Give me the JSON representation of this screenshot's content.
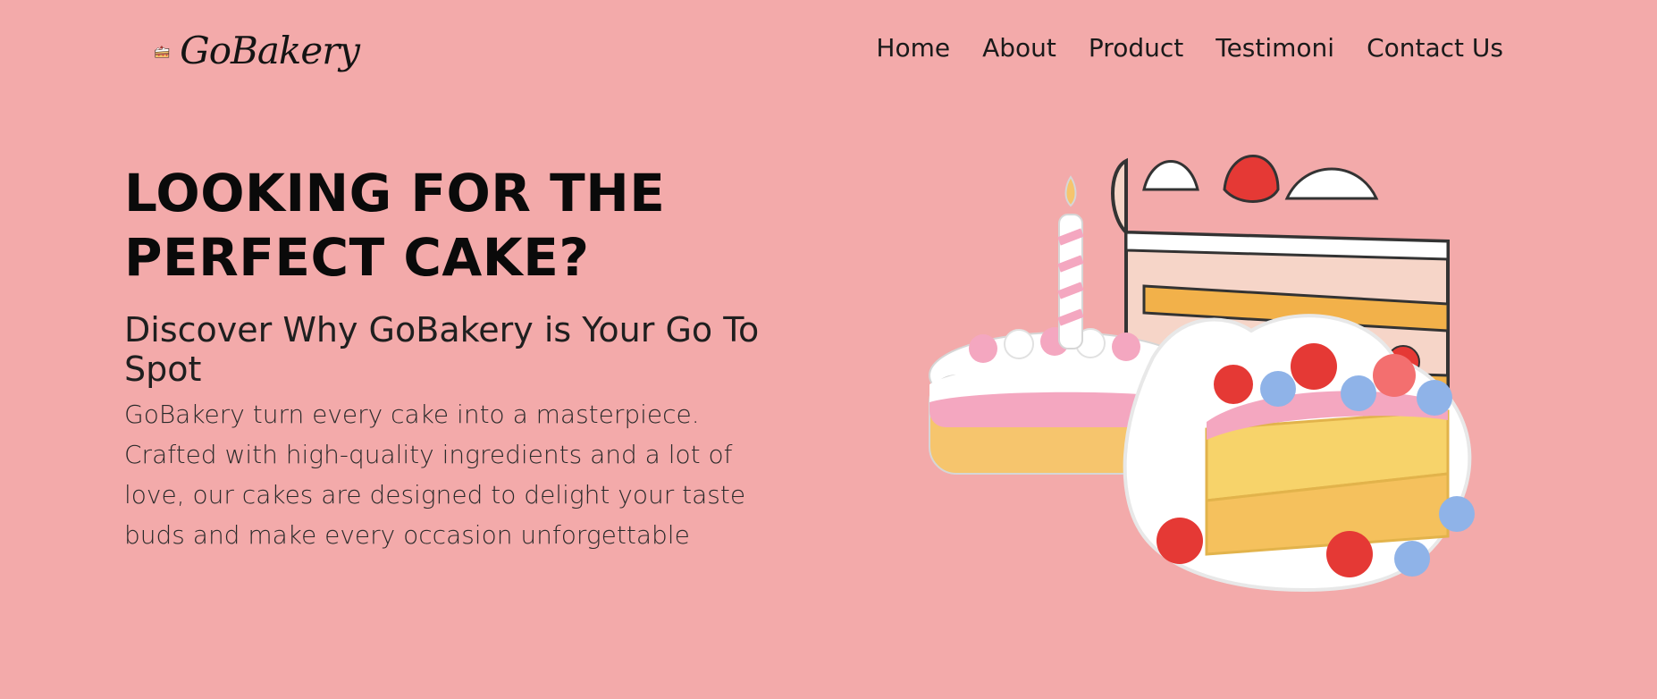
{
  "colors": {
    "background": "#F3AAAA",
    "text_primary": "#0A0A0A",
    "text_secondary": "#2A2A2A"
  },
  "brand": {
    "name": "GoBakery",
    "logo_icon": "cake-slice-icon"
  },
  "nav": {
    "items": [
      {
        "label": "Home"
      },
      {
        "label": "About"
      },
      {
        "label": "Product"
      },
      {
        "label": "Testimoni"
      },
      {
        "label": "Contact Us"
      }
    ]
  },
  "hero": {
    "title_line1": "LOOKING FOR THE",
    "title_line2": "PERFECT CAKE?",
    "subtitle": "Discover Why GoBakery is Your Go To Spot",
    "description": "GoBakery turn every cake into a masterpiece. Crafted with high-quality ingredients and a lot of love, our cakes are designed to delight your taste buds and make every occasion unforgettable",
    "image_icon": "cakes-illustration"
  }
}
